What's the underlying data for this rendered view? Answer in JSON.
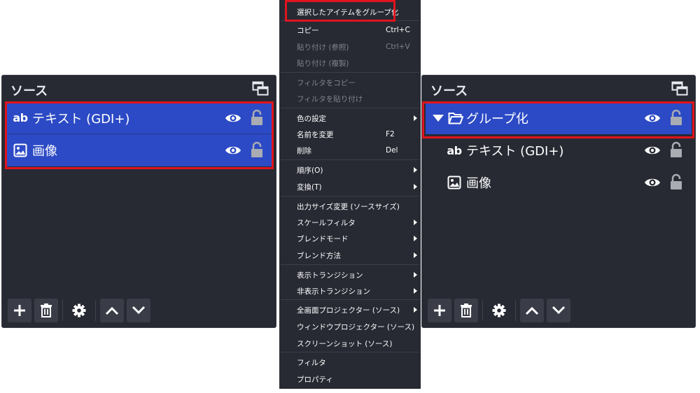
{
  "left_panel": {
    "title": "ソース",
    "items": [
      {
        "icon": "text-ab-icon",
        "icon_text": "ab",
        "label": "テキスト (GDI+)"
      },
      {
        "icon": "image-icon",
        "label": "画像"
      }
    ]
  },
  "right_panel": {
    "title": "ソース",
    "group": {
      "icon": "folder-icon",
      "label": "グループ化"
    },
    "items": [
      {
        "icon": "text-ab-icon",
        "icon_text": "ab",
        "label": "テキスト (GDI+)"
      },
      {
        "icon": "image-icon",
        "label": "画像"
      }
    ]
  },
  "toolbar_icons": [
    "plus-icon",
    "trash-icon",
    "gear-icon",
    "chevron-up-icon",
    "chevron-down-icon"
  ],
  "context_menu": {
    "items": [
      {
        "label": "選択したアイテムをグループ化",
        "highlighted": true
      },
      {
        "label": "コピー",
        "shortcut": "Ctrl+C"
      },
      {
        "label": "貼り付け (参照)",
        "shortcut": "Ctrl+V",
        "disabled": true
      },
      {
        "label": "貼り付け (複製)",
        "disabled": true
      },
      {
        "label": "フィルタをコピー",
        "disabled": true
      },
      {
        "label": "フィルタを貼り付け",
        "disabled": true
      },
      {
        "label": "色の設定",
        "submenu": true
      },
      {
        "label": "名前を変更",
        "shortcut": "F2"
      },
      {
        "label": "削除",
        "shortcut": "Del"
      },
      {
        "label": "順序(O)",
        "submenu": true
      },
      {
        "label": "変換(T)",
        "submenu": true
      },
      {
        "label": "出力サイズ変更 (ソースサイズ)"
      },
      {
        "label": "スケールフィルタ",
        "submenu": true
      },
      {
        "label": "ブレンドモード",
        "submenu": true
      },
      {
        "label": "ブレンド方法",
        "submenu": true
      },
      {
        "label": "表示トランジション",
        "submenu": true
      },
      {
        "label": "非表示トランジション",
        "submenu": true
      },
      {
        "label": "全画面プロジェクター (ソース)",
        "submenu": true
      },
      {
        "label": "ウィンドウプロジェクター (ソース)"
      },
      {
        "label": "スクリーンショット (ソース)"
      },
      {
        "label": "フィルタ"
      },
      {
        "label": "プロパティ"
      }
    ]
  },
  "colors": {
    "panel_bg": "#272a33",
    "selection": "#2c4ac5",
    "highlight_frame": "#e0141e",
    "button_bg": "#3a3d48"
  }
}
